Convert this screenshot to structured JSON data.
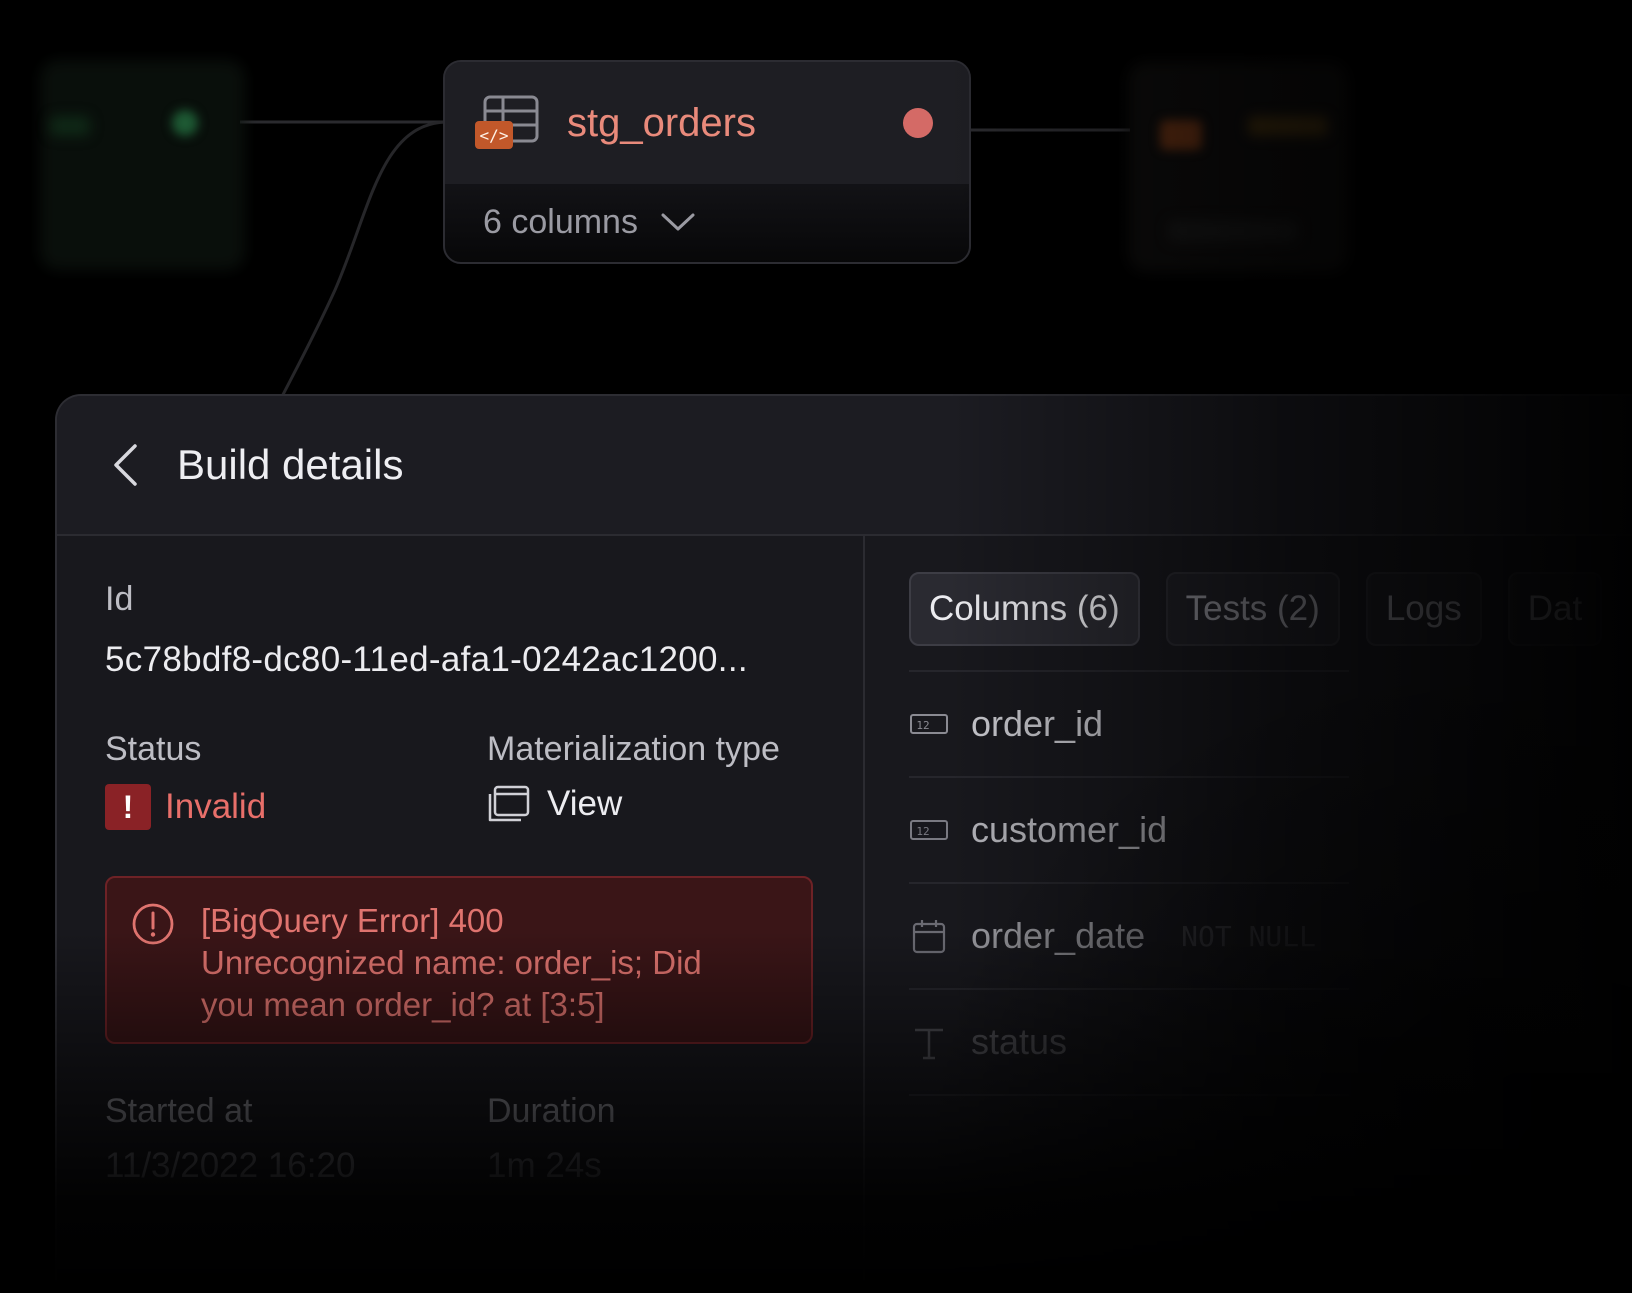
{
  "node": {
    "title": "stg_orders",
    "columns_label": "6 columns",
    "status_color": "#d46a66",
    "title_color": "#e98a7b",
    "icon": "sql-model-table-icon"
  },
  "panel": {
    "title": "Build details",
    "back_icon": "chevron-left-icon",
    "id": {
      "label": "Id",
      "value": "5c78bdf8-dc80-11ed-afa1-0242ac1200..."
    },
    "status": {
      "label": "Status",
      "value": "Invalid",
      "badge": "!",
      "color": "#e86f6a"
    },
    "materialization": {
      "label": "Materialization type",
      "value": "View",
      "icon": "view-window-icon"
    },
    "error": {
      "icon": "alert-circle-icon",
      "lines": [
        "[BigQuery Error] 400",
        "Unrecognized name: order_is; Did",
        "you mean order_id? at [3:5]"
      ],
      "color": "#e0746f"
    },
    "started": {
      "label": "Started at",
      "value": "11/3/2022 16:20"
    },
    "duration": {
      "label": "Duration",
      "value": "1m 24s"
    },
    "tabs": [
      {
        "label": "Columns (6)",
        "active": true
      },
      {
        "label": "Tests (2)",
        "active": false
      },
      {
        "label": "Logs",
        "active": false
      },
      {
        "label": "Dat",
        "active": false
      }
    ],
    "columns": [
      {
        "name": "order_id",
        "type_icon": "numeric-type-icon",
        "meta": ""
      },
      {
        "name": "customer_id",
        "type_icon": "numeric-type-icon",
        "meta": ""
      },
      {
        "name": "order_date",
        "type_icon": "calendar-type-icon",
        "meta": "NOT NULL"
      },
      {
        "name": "status",
        "type_icon": "text-type-icon",
        "meta": ""
      }
    ]
  }
}
